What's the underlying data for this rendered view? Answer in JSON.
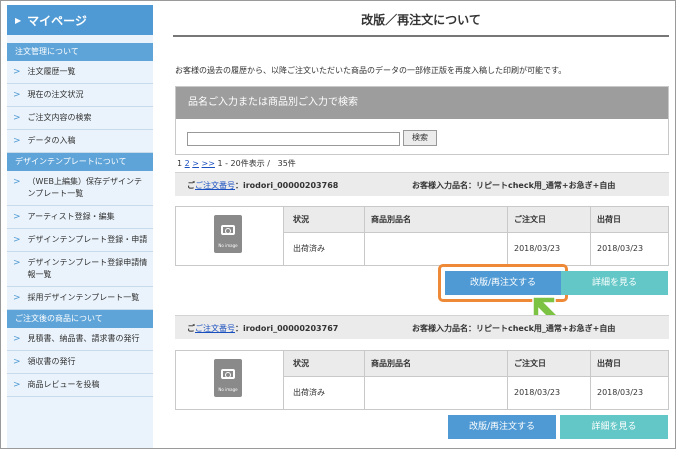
{
  "sidebar": {
    "mypage": "マイページ",
    "sections": [
      {
        "title": "注文管理について"
      },
      {
        "title": "デザインテンプレートについて"
      },
      {
        "title": "ご注文後の商品について"
      }
    ],
    "items_order": [
      "注文履歴一覧",
      "現在の注文状況",
      "ご注文内容の検索",
      "データの入稿"
    ],
    "items_design": [
      "（WEB上編集）保存デザインテンプレート一覧",
      "アーティスト登録・編集",
      "デザインテンプレート登録・申請",
      "デザインテンプレート登録申請情報一覧",
      "採用デザインテンプレート一覧"
    ],
    "items_after": [
      "見積書、納品書、請求書の発行",
      "領収書の発行",
      "商品レビューを投稿"
    ]
  },
  "main": {
    "title": "改版／再注文について",
    "description": "お客様の過去の履歴から、以降ご注文いただいた商品のデータの一部修正版を再度入稿した印刷が可能です。",
    "search": {
      "heading": "品名ご入力または商品別ご入力で検索",
      "placeholder": "",
      "button": "検索"
    },
    "pager": {
      "current": "1",
      "p2": "2",
      "next": ">",
      "last": ">>",
      "range": "1 - 20件表示 /",
      "total": "35件"
    },
    "order_number_label": "ご注文番号",
    "customer_name_label": "お客様入力品名：",
    "table_headers": {
      "status": "状況",
      "product_name": "商品別品名",
      "order_date": "ご注文日",
      "ship_date": "出荷日"
    },
    "no_image": "No image",
    "buttons": {
      "reorder": "改版/再注文する",
      "details": "詳細を見る"
    },
    "orders": [
      {
        "order_number": "：irodori_00000203768",
        "customer_name": "リピートcheck用_通常+お急ぎ+自由",
        "status": "出荷済み",
        "product_name": "",
        "order_date": "2018/03/23",
        "ship_date": "2018/03/23"
      },
      {
        "order_number": "：irodori_00000203767",
        "customer_name": "リピートcheck用_通常+お急ぎ+自由",
        "status": "出荷済み",
        "product_name": "",
        "order_date": "2018/03/23",
        "ship_date": "2018/03/23"
      }
    ]
  },
  "colors": {
    "sidebar_bg": "#eaf3fb",
    "accent_blue": "#4f9ad4",
    "teal": "#63c7c7",
    "highlight": "#ee8a37",
    "arrow": "#7cc243"
  }
}
